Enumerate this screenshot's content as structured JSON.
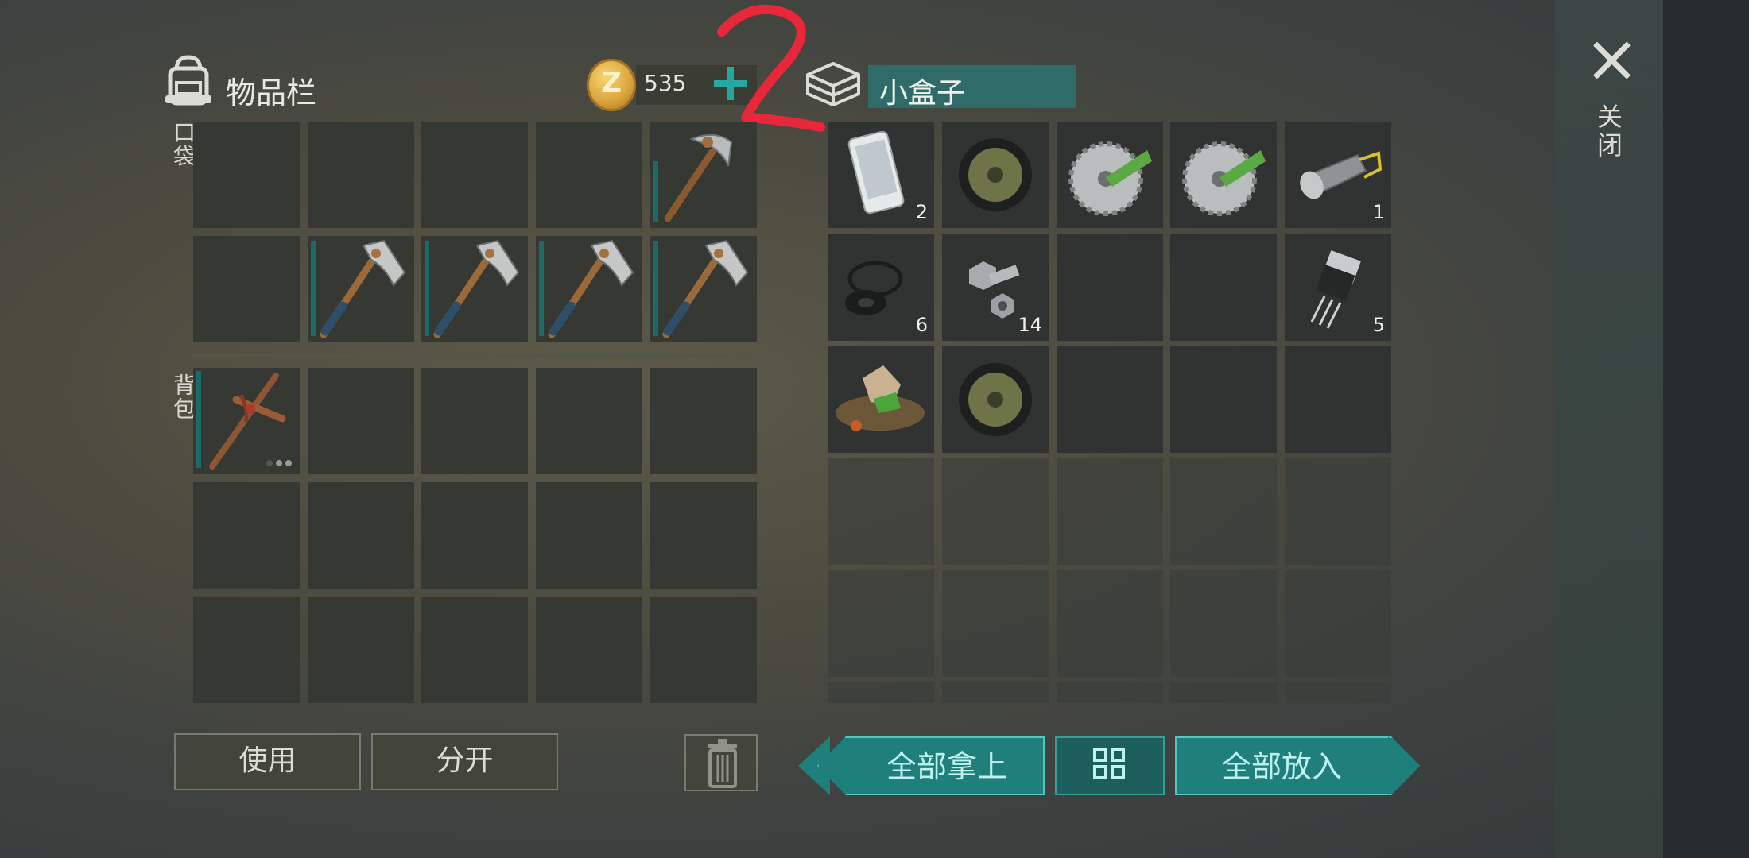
{
  "inventory": {
    "title": "物品栏",
    "pocket_label": "口袋",
    "backpack_label": "背包",
    "coins": "535",
    "pocket": [
      {
        "item": "",
        "qty": ""
      },
      {
        "item": "",
        "qty": ""
      },
      {
        "item": "",
        "qty": ""
      },
      {
        "item": "",
        "qty": ""
      },
      {
        "item": "pickaxe-icon",
        "qty": "",
        "durability": 0.7
      },
      {
        "item": "",
        "qty": ""
      },
      {
        "item": "hatchet-icon",
        "qty": "",
        "durability": 0.95
      },
      {
        "item": "hatchet-icon",
        "qty": "",
        "durability": 0.95
      },
      {
        "item": "hatchet-icon",
        "qty": "",
        "durability": 0.95
      },
      {
        "item": "hatchet-icon",
        "qty": "",
        "durability": 0.95
      }
    ],
    "backpack": [
      {
        "item": "crude-pickaxe-icon",
        "qty": "",
        "durability": 0.98
      }
    ]
  },
  "container": {
    "name": "小盒子",
    "items": [
      {
        "item": "smartphone-icon",
        "qty": "2"
      },
      {
        "item": "wheel-icon",
        "qty": ""
      },
      {
        "item": "saw-blade-icon",
        "qty": ""
      },
      {
        "item": "saw-blade-icon",
        "qty": ""
      },
      {
        "item": "flashlight-icon",
        "qty": "1"
      },
      {
        "item": "rubber-rings-icon",
        "qty": "6"
      },
      {
        "item": "bolts-icon",
        "qty": "14"
      },
      {
        "item": "",
        "qty": ""
      },
      {
        "item": "",
        "qty": ""
      },
      {
        "item": "transistor-icon",
        "qty": "5"
      },
      {
        "item": "scrap-pile-icon",
        "qty": ""
      },
      {
        "item": "wheel-icon",
        "qty": ""
      }
    ]
  },
  "buttons": {
    "use": "使用",
    "split": "分开",
    "take_all": "全部拿上",
    "put_all": "全部放入",
    "close": "关闭"
  },
  "colors": {
    "accent": "#1f7f7b",
    "annotation": "#e8283a"
  }
}
